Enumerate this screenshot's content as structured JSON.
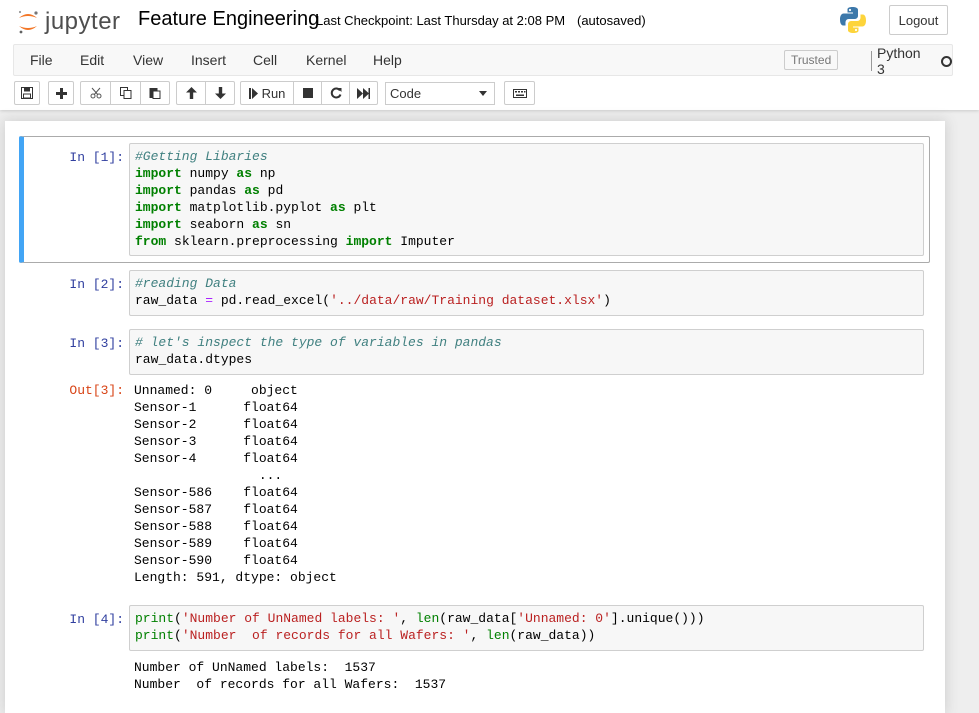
{
  "header": {
    "logo_text": "jupyter",
    "notebook_name": "Feature Engineering",
    "checkpoint": "Last Checkpoint: Last Thursday at 2:08 PM",
    "autosave": "(autosaved)",
    "logout_label": "Logout"
  },
  "menubar": {
    "items": [
      "File",
      "Edit",
      "View",
      "Insert",
      "Cell",
      "Kernel",
      "Help"
    ],
    "trusted_label": "Trusted",
    "kernel_name": "Python 3"
  },
  "toolbar": {
    "run_label": "Run",
    "cell_type": "Code"
  },
  "cells": [
    {
      "prompt": "In [1]:",
      "lines": [
        [
          {
            "t": "#Getting Libaries",
            "c": "cm-comment"
          }
        ],
        [
          {
            "t": "import",
            "c": "cm-keyword"
          },
          {
            "t": " numpy ",
            "c": "cm-var"
          },
          {
            "t": "as",
            "c": "cm-keyword"
          },
          {
            "t": " np",
            "c": "cm-var"
          }
        ],
        [
          {
            "t": "import",
            "c": "cm-keyword"
          },
          {
            "t": " pandas ",
            "c": "cm-var"
          },
          {
            "t": "as",
            "c": "cm-keyword"
          },
          {
            "t": " pd",
            "c": "cm-var"
          }
        ],
        [
          {
            "t": "import",
            "c": "cm-keyword"
          },
          {
            "t": " matplotlib.pyplot ",
            "c": "cm-var"
          },
          {
            "t": "as",
            "c": "cm-keyword"
          },
          {
            "t": " plt",
            "c": "cm-var"
          }
        ],
        [
          {
            "t": "import",
            "c": "cm-keyword"
          },
          {
            "t": " seaborn ",
            "c": "cm-var"
          },
          {
            "t": "as",
            "c": "cm-keyword"
          },
          {
            "t": " sn",
            "c": "cm-var"
          }
        ],
        [
          {
            "t": "from",
            "c": "cm-keyword"
          },
          {
            "t": " sklearn.preprocessing ",
            "c": "cm-var"
          },
          {
            "t": "import",
            "c": "cm-keyword"
          },
          {
            "t": " Imputer",
            "c": "cm-var"
          }
        ]
      ]
    },
    {
      "prompt": "In [2]:",
      "lines": [
        [
          {
            "t": "#reading Data",
            "c": "cm-comment"
          }
        ],
        [
          {
            "t": "raw_data ",
            "c": "cm-var"
          },
          {
            "t": "=",
            "c": "cm-op"
          },
          {
            "t": " pd.read_excel(",
            "c": "cm-var"
          },
          {
            "t": "'../data/raw/Training dataset.xlsx'",
            "c": "cm-string"
          },
          {
            "t": ")",
            "c": "cm-var"
          }
        ]
      ]
    },
    {
      "prompt": "In [3]:",
      "lines": [
        [
          {
            "t": "# let's inspect the type of variables in pandas",
            "c": "cm-comment"
          }
        ],
        [
          {
            "t": "raw_data.dtypes",
            "c": "cm-var"
          }
        ]
      ],
      "out_prompt": "Out[3]:",
      "output": [
        "Unnamed: 0     object",
        "Sensor-1      float64",
        "Sensor-2      float64",
        "Sensor-3      float64",
        "Sensor-4      float64",
        "                ...  ",
        "Sensor-586    float64",
        "Sensor-587    float64",
        "Sensor-588    float64",
        "Sensor-589    float64",
        "Sensor-590    float64",
        "Length: 591, dtype: object"
      ]
    },
    {
      "prompt": "In [4]:",
      "lines": [
        [
          {
            "t": "print",
            "c": "cm-builtin"
          },
          {
            "t": "(",
            "c": "cm-var"
          },
          {
            "t": "'Number of UnNamed labels: '",
            "c": "cm-string"
          },
          {
            "t": ", ",
            "c": "cm-var"
          },
          {
            "t": "len",
            "c": "cm-builtin"
          },
          {
            "t": "(raw_data[",
            "c": "cm-var"
          },
          {
            "t": "'Unnamed: 0'",
            "c": "cm-string"
          },
          {
            "t": "].unique()))",
            "c": "cm-var"
          }
        ],
        [
          {
            "t": "print",
            "c": "cm-builtin"
          },
          {
            "t": "(",
            "c": "cm-var"
          },
          {
            "t": "'Number  of records for all Wafers: '",
            "c": "cm-string"
          },
          {
            "t": ", ",
            "c": "cm-var"
          },
          {
            "t": "len",
            "c": "cm-builtin"
          },
          {
            "t": "(raw_data))",
            "c": "cm-var"
          }
        ]
      ],
      "output": [
        "Number of UnNamed labels:  1537",
        "Number  of records for all Wafers:  1537"
      ]
    }
  ],
  "colors": {
    "in_prompt": "#303f9f",
    "out_prompt": "#d84315",
    "selected_border": "#42a5f5"
  }
}
